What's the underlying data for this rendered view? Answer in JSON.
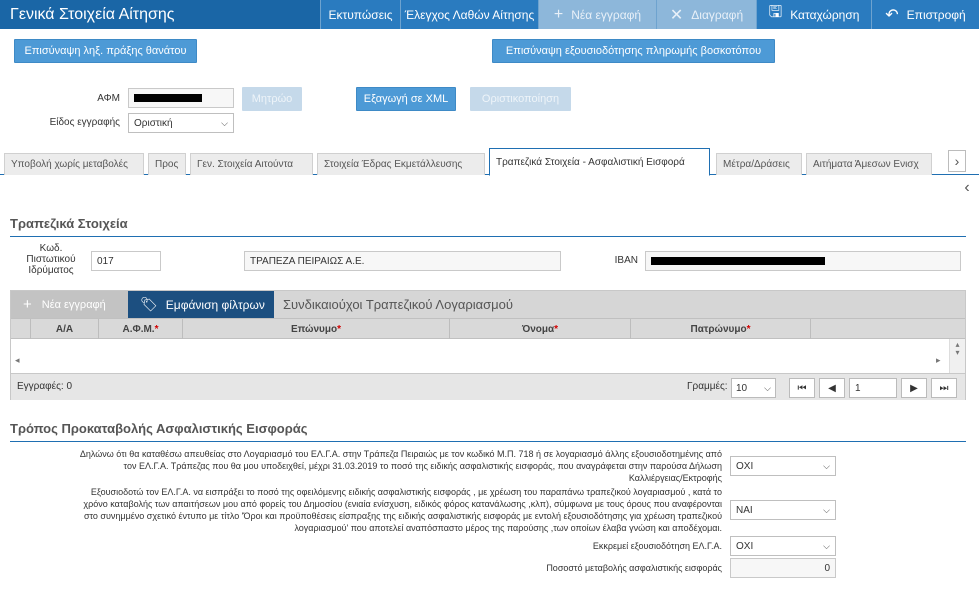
{
  "header": {
    "title": "Γενικά Στοιχεία Αίτησης",
    "buttons": {
      "print": "Εκτυπώσεις",
      "check_errors": "Έλεγχος Λαθών Αίτησης",
      "new_record": "Νέα εγγραφή",
      "delete": "Διαγραφή",
      "save": "Καταχώρηση",
      "back": "Επιστροφή"
    }
  },
  "top_actions": {
    "death_cert": "Επισύναψη ληξ. πράξης θανάτου",
    "pasture_auth": "Επισύναψη εξουσιοδότησης πληρωμής βοσκοτόπου"
  },
  "form": {
    "afm_label": "ΑΦΜ",
    "record_type_label": "Είδος εγγραφής",
    "record_type_value": "Οριστική",
    "registry_button": "Μητρώο",
    "export_xml": "Εξαγωγή σε XML",
    "finalize": "Οριστικοποίηση"
  },
  "tabs": [
    "Υποβολή χωρίς μεταβολές",
    "Προς",
    "Γεν. Στοιχεία Αιτούντα",
    "Στοιχεία Έδρας Εκμετάλλευσης",
    "Τραπεζικά Στοιχεία - Ασφαλιστική Εισφορά",
    "Μέτρα/Δράσεις",
    "Αιτήματα Άμεσων Ενισχ"
  ],
  "bank": {
    "section_title": "Τραπεζικά Στοιχεία",
    "code_label_1": "Κωδ.",
    "code_label_2": "Πιστωτικού",
    "code_label_3": "Ιδρύματος",
    "code_value": "017",
    "bank_name": "ΤΡΑΠΕΖΑ ΠΕΙΡΑΙΩΣ Α.Ε.",
    "iban_label": "IBAN"
  },
  "grid": {
    "new_record": "Νέα εγγραφή",
    "show_filters": "Εμφάνιση φίλτρων",
    "title": "Συνδικαιούχοι Τραπεζικού Λογαριασμού",
    "columns": [
      "Α/Α",
      "Α.Φ.Μ.",
      "Επώνυμο",
      "Όνομα",
      "Πατρώνυμο"
    ],
    "records_label": "Εγγραφές: 0",
    "rows_label": "Γραμμές:",
    "rows_value": "10",
    "page_value": "1"
  },
  "contribution": {
    "section_title": "Τρόπος Προκαταβολής Ασφαλιστικής Εισφοράς",
    "q1_lines": [
      "Δηλώνω ότι θα καταθέσω απευθείας στο Λογαριασμό του ΕΛ.Γ.Α. στην Τράπεζα Πειραιώς με τον κωδικό Μ.Π. 718 ή σε λογαριασμό άλλης εξουσιοδοτημένης από",
      "τον ΕΛ.Γ.Α. Τράπεζας που θα μου υποδειχθεί, μέχρι 31.03.2019 το ποσό της ειδικής ασφαλιστικής εισφοράς, που αναγράφεται στην παρούσα Δήλωση",
      "Καλλιέργειας/Εκτροφής"
    ],
    "q1_value": "ΟΧΙ",
    "q2_lines": [
      "Εξουσιοδοτώ τον ΕΛ.Γ.Α. να εισπράξει το ποσό της οφειλόμενης ειδικής ασφαλιστικής εισφοράς , με χρέωση του παραπάνω τραπεζικού λογαριασμού , κατά το",
      "χρόνο καταβολής των απαιτήσεων μου από φορείς του Δημοσίου (ενιαία ενίσχυση, ειδικός φόρος κατανάλωσης ,κλπ), σύμφωνα με τους όρους που αναφέρονται",
      "στο συνημμένο σχετικό έντυπο με τίτλο 'Όροι και προϋποθέσεις είσπραξης της ειδικής ασφαλιστικής εισφοράς με εντολή εξουσιοδότησης για χρέωση τραπεζικού",
      "λογαριασμού' που αποτελεί αναπόσπαστο μέρος της παρούσης ,των οποίων έλαβα γνώση και αποδέχομαι."
    ],
    "q2_value": "ΝΑΙ",
    "q3_label": "Εκκρεμεί εξουσιοδότηση ΕΛ.Γ.Α.",
    "q3_value": "ΟΧΙ",
    "q4_label": "Ποσοστό μεταβολής ασφαλιστικής εισφοράς",
    "q4_value": "0"
  }
}
